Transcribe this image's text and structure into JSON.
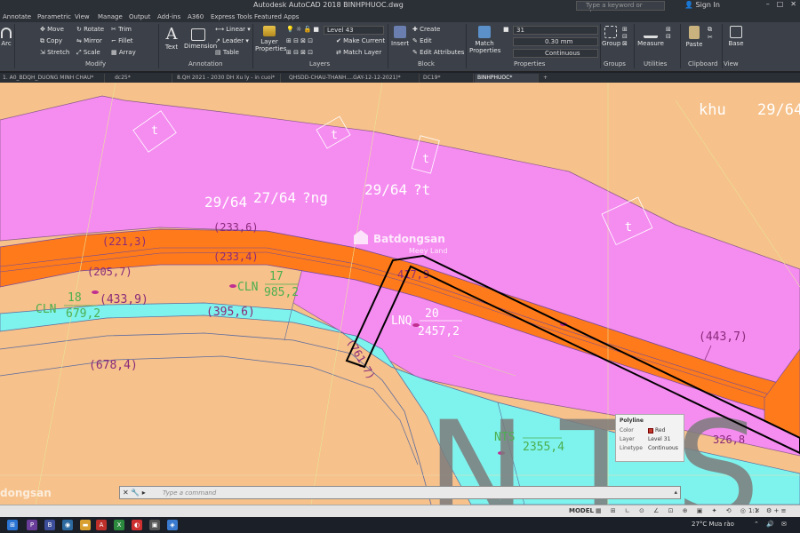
{
  "window": {
    "title": "Autodesk AutoCAD 2018   BINHPHUOC.dwg",
    "search_placeholder": "Type a keyword or phrase",
    "sign_in": "Sign In",
    "controls": [
      "–",
      "□",
      "✕"
    ]
  },
  "menu_tabs": [
    "Annotate",
    "Parametric",
    "View",
    "Manage",
    "Output",
    "Add-ins",
    "A360",
    "Express Tools",
    "Featured Apps"
  ],
  "ribbon": {
    "draw": {
      "arc": "Arc"
    },
    "modify": {
      "title": "Modify",
      "items": [
        "Move",
        "Rotate",
        "Trim",
        "Copy",
        "Mirror",
        "Fillet",
        "Stretch",
        "Scale",
        "Array"
      ]
    },
    "annotation": {
      "title": "Annotation",
      "text": "Text",
      "dimension": "Dimension",
      "linear": "Linear",
      "leader": "Leader",
      "table": "Table"
    },
    "layers": {
      "title": "Layers",
      "layer_properties": "Layer Properties",
      "current_layer": "Level 43",
      "make_current": "Make Current",
      "match_layer": "Match Layer"
    },
    "block": {
      "title": "Block",
      "insert": "Insert",
      "create": "Create",
      "edit": "Edit",
      "edit_attributes": "Edit Attributes"
    },
    "properties": {
      "title": "Properties",
      "match_properties": "Match Properties",
      "color": "31",
      "lineweight": "0.30 mm",
      "linetype": "Continuous"
    },
    "groups": {
      "title": "Groups",
      "group": "Group"
    },
    "utilities": {
      "title": "Utilities",
      "measure": "Measure"
    },
    "clipboard": {
      "title": "Clipboard",
      "paste": "Paste"
    },
    "view": {
      "title": "View",
      "base": "Base"
    }
  },
  "file_tabs": [
    "1. A0_BDQH_DUONG MINH CHAU*",
    "dc25*",
    "8.QH 2021 - 2030 DH Xu ly - in cuoi*",
    "QHSDD-CHAU-THANH....GAY-12-12-2021)*",
    "DC19*",
    "BINHPHUOC*"
  ],
  "drawing": {
    "labels": {
      "t1": "t",
      "t2": "t",
      "t3": "t",
      "t4": "t",
      "khu": "khu",
      "frac_top_right": "29/64",
      "frac_a": "29/64",
      "frac_b": "27/64",
      "frac_b_text": "?ng",
      "frac_c": "29/64",
      "frac_c_text": "?t",
      "v221": "(221,3)",
      "v233a": "(233,6)",
      "v233b": "(233,4)",
      "v205": "(205,7)",
      "v417": "417,9",
      "v433": "(433,9)",
      "v395": "(395,6)",
      "v678": "(678,4)",
      "v761": "(761,7)",
      "v443": "(443,7)",
      "v326": "326,8",
      "cln18": "CLN",
      "cln18_num": "18",
      "cln18_area": "679,2",
      "cln17": "CLN",
      "cln17_num": "17",
      "cln17_area": "985,2",
      "lnq": "LNQ",
      "lnq_num": "20",
      "lnq_area": "2457,2",
      "nts": "NTS",
      "nts_area": "2355,4",
      "big_nts": "NTS"
    },
    "colors": {
      "background": "#f6c18a",
      "magenta": "#f58cf0",
      "road": "#ff7a1a",
      "cyan": "#7ef2ec",
      "selection": "#000000"
    }
  },
  "watermarks": {
    "brand": "Batdongsan",
    "sub": "Meey Land",
    "corner": "dongsan"
  },
  "properties_tooltip": {
    "title": "Polyline",
    "rows": [
      {
        "key": "Color",
        "value": "Red"
      },
      {
        "key": "Layer",
        "value": "Level 31"
      },
      {
        "key": "Linetype",
        "value": "Continuous"
      }
    ]
  },
  "command_line": {
    "placeholder": "Type a command"
  },
  "status_bar": {
    "model": "MODEL",
    "scale": "1:1"
  },
  "taskbar": {
    "weather": "27°C  Mưa rào"
  }
}
